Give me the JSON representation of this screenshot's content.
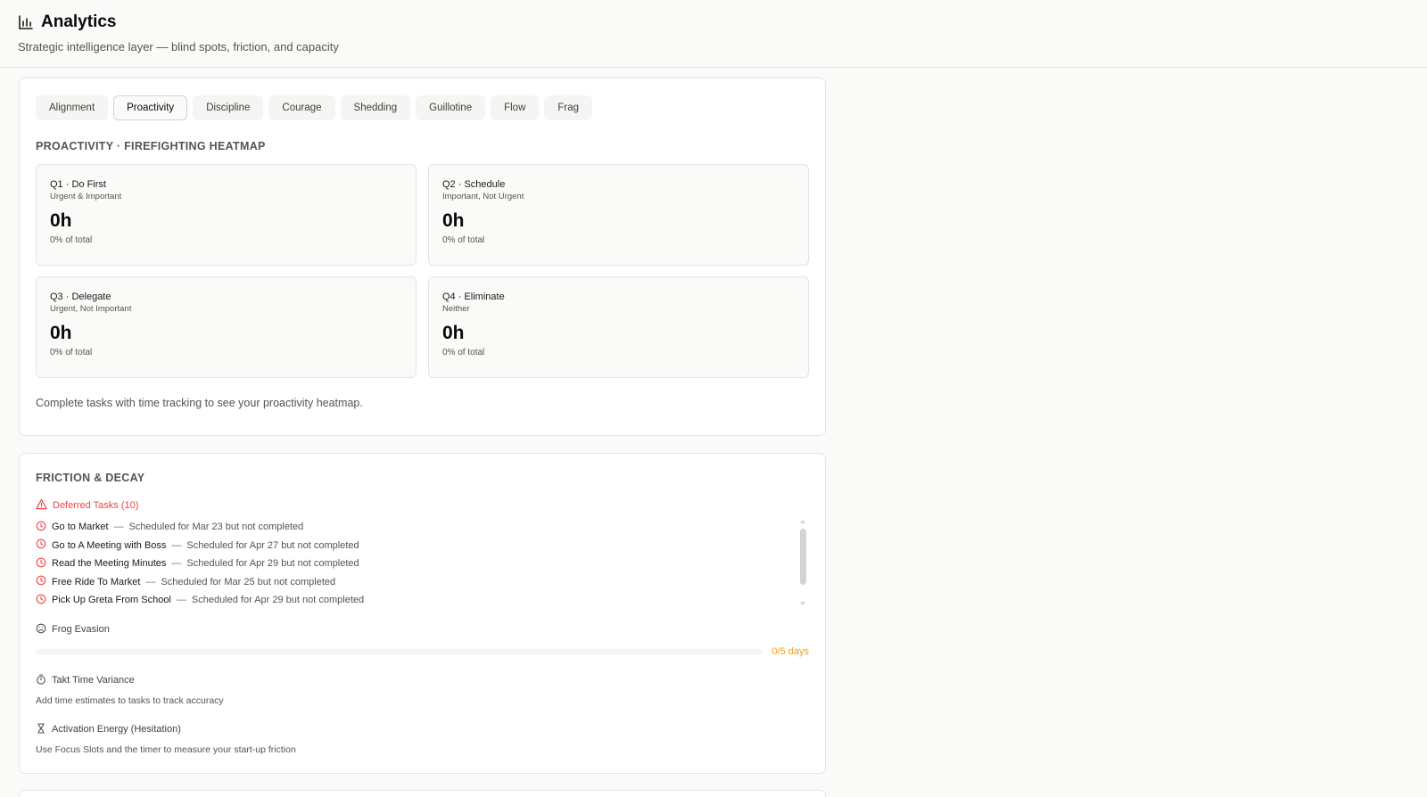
{
  "header": {
    "title": "Analytics",
    "subtitle": "Strategic intelligence layer — blind spots, friction, and capacity",
    "icon": "bar-chart-icon"
  },
  "tabs": [
    {
      "label": "Alignment",
      "active": false
    },
    {
      "label": "Proactivity",
      "active": true
    },
    {
      "label": "Discipline",
      "active": false
    },
    {
      "label": "Courage",
      "active": false
    },
    {
      "label": "Shedding",
      "active": false
    },
    {
      "label": "Guillotine",
      "active": false
    },
    {
      "label": "Flow",
      "active": false
    },
    {
      "label": "Frag",
      "active": false
    }
  ],
  "proactivity": {
    "section_label": "PROACTIVITY · FIREFIGHTING HEATMAP",
    "quadrants": [
      {
        "title": "Q1 · Do First",
        "subtitle": "Urgent & Important",
        "value": "0h",
        "percent": "0% of total"
      },
      {
        "title": "Q2 · Schedule",
        "subtitle": "Important, Not Urgent",
        "value": "0h",
        "percent": "0% of total"
      },
      {
        "title": "Q3 · Delegate",
        "subtitle": "Urgent, Not Important",
        "value": "0h",
        "percent": "0% of total"
      },
      {
        "title": "Q4 · Eliminate",
        "subtitle": "Neither",
        "value": "0h",
        "percent": "0% of total"
      }
    ],
    "hint": "Complete tasks with time tracking to see your proactivity heatmap."
  },
  "friction": {
    "section_label": "FRICTION & DECAY",
    "deferred_title": "Deferred Tasks (10)",
    "deferred_items": [
      {
        "name": "Go to Market",
        "dash": "—",
        "note": "Scheduled for Mar 23 but not completed"
      },
      {
        "name": "Go to A Meeting with Boss",
        "dash": "—",
        "note": "Scheduled for Apr 27 but not completed"
      },
      {
        "name": "Read the Meeting Minutes",
        "dash": "—",
        "note": "Scheduled for Apr 29 but not completed"
      },
      {
        "name": "Free Ride To Market",
        "dash": "—",
        "note": "Scheduled for Mar 25 but not completed"
      },
      {
        "name": "Pick Up Greta From School",
        "dash": "—",
        "note": "Scheduled for Apr 29 but not completed"
      }
    ],
    "frog": {
      "label": "Frog Evasion",
      "progress_label": "0/5 days",
      "progress_fraction": 0
    },
    "takt": {
      "label": "Takt Time Variance",
      "note": "Add time estimates to tasks to track accuracy"
    },
    "activation": {
      "label": "Activation Energy (Hesitation)",
      "note": "Use Focus Slots and the timer to measure your start-up friction"
    }
  },
  "colors": {
    "danger": "#ef4444",
    "warning": "#f59e0b",
    "muted": "#57534e",
    "border": "#e7e5e4"
  }
}
